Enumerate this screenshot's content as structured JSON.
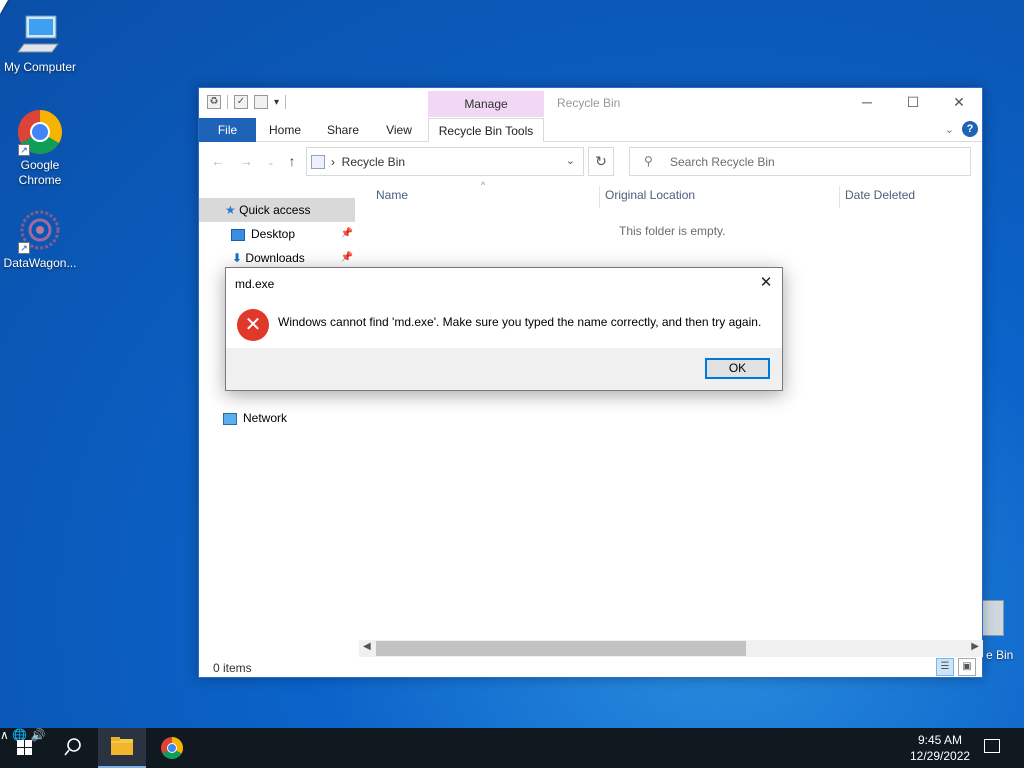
{
  "desktop": {
    "icons": [
      {
        "label": "My Computer"
      },
      {
        "label": "Google Chrome"
      },
      {
        "label": "DataWagon..."
      }
    ],
    "recycle_label_partial": "e Bin"
  },
  "explorer": {
    "title": "Recycle Bin",
    "manage_tab": "Manage",
    "ribbon_tabs": {
      "file": "File",
      "home": "Home",
      "share": "Share",
      "view": "View",
      "tools": "Recycle Bin Tools"
    },
    "address": {
      "crumb": "Recycle Bin"
    },
    "search": {
      "placeholder": "Search Recycle Bin"
    },
    "nav": {
      "quick_access": "Quick access",
      "desktop": "Desktop",
      "downloads": "Downloads",
      "network": "Network"
    },
    "columns": {
      "name": "Name",
      "original_location": "Original Location",
      "date_deleted": "Date Deleted"
    },
    "empty_message": "This folder is empty.",
    "status": {
      "count": "0 items"
    }
  },
  "dialog": {
    "title": "md.exe",
    "message": "Windows cannot find 'md.exe'. Make sure you typed the name correctly, and then try again.",
    "ok_label": "OK"
  },
  "taskbar": {
    "time": "9:45 AM",
    "date": "12/29/2022"
  },
  "colors": {
    "accent": "#0078d7",
    "file_tab": "#1e63b8",
    "manage_tab": "#f1d8f5",
    "error": "#e0392b"
  }
}
